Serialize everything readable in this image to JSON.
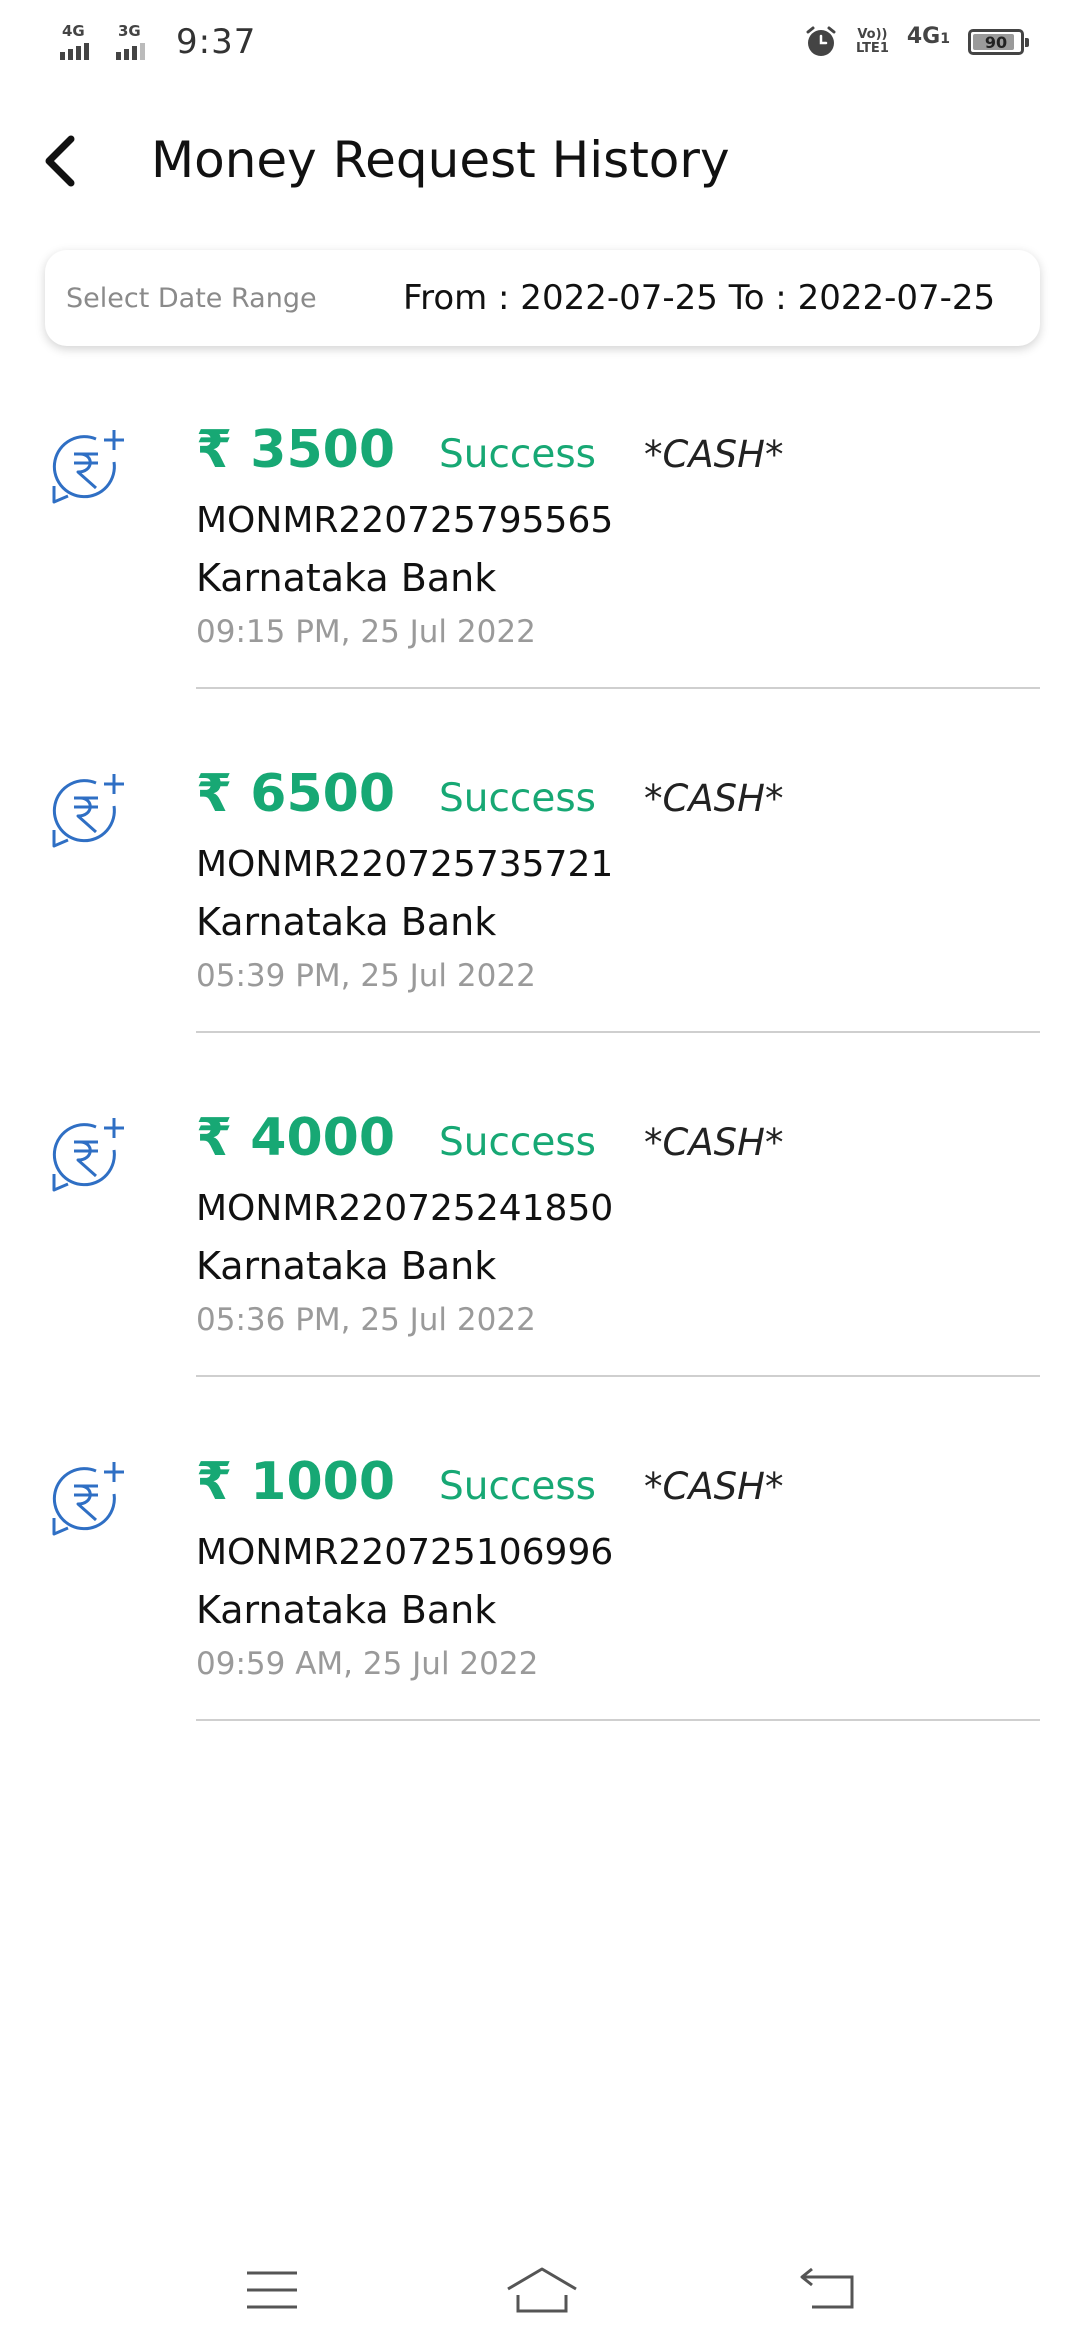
{
  "status_bar": {
    "sim1_network": "4G",
    "sim2_network": "3G",
    "time": "9:37",
    "volte_top": "Vo))",
    "volte_bottom": "LTE1",
    "data_network": "4G",
    "data_sub": "1",
    "battery_level": "90",
    "battery_fraction": 0.9
  },
  "header": {
    "title": "Money Request History"
  },
  "date_range": {
    "label": "Select Date Range",
    "value": "From : 2022-07-25 To :  2022-07-25"
  },
  "colors": {
    "success_green": "#17a874",
    "icon_blue": "#2f6fc4",
    "muted_gray": "#9a9a9a"
  },
  "transactions": [
    {
      "icon": "rupee-request-icon",
      "amount": "₹ 3500",
      "status": "Success",
      "mode": "*CASH*",
      "reference": "MONMR220725795565",
      "bank": "Karnataka Bank",
      "timestamp": "09:15 PM, 25 Jul 2022"
    },
    {
      "icon": "rupee-request-icon",
      "amount": "₹ 6500",
      "status": "Success",
      "mode": "*CASH*",
      "reference": "MONMR220725735721",
      "bank": "Karnataka Bank",
      "timestamp": "05:39 PM, 25 Jul 2022"
    },
    {
      "icon": "rupee-request-icon",
      "amount": "₹ 4000",
      "status": "Success",
      "mode": "*CASH*",
      "reference": "MONMR220725241850",
      "bank": "Karnataka Bank",
      "timestamp": "05:36 PM, 25 Jul 2022"
    },
    {
      "icon": "rupee-request-icon",
      "amount": "₹ 1000",
      "status": "Success",
      "mode": "*CASH*",
      "reference": "MONMR220725106996",
      "bank": "Karnataka Bank",
      "timestamp": "09:59 AM, 25 Jul 2022"
    }
  ],
  "nav": {
    "menu_icon": "menu-icon",
    "home_icon": "home-icon",
    "back_icon": "back-icon"
  }
}
